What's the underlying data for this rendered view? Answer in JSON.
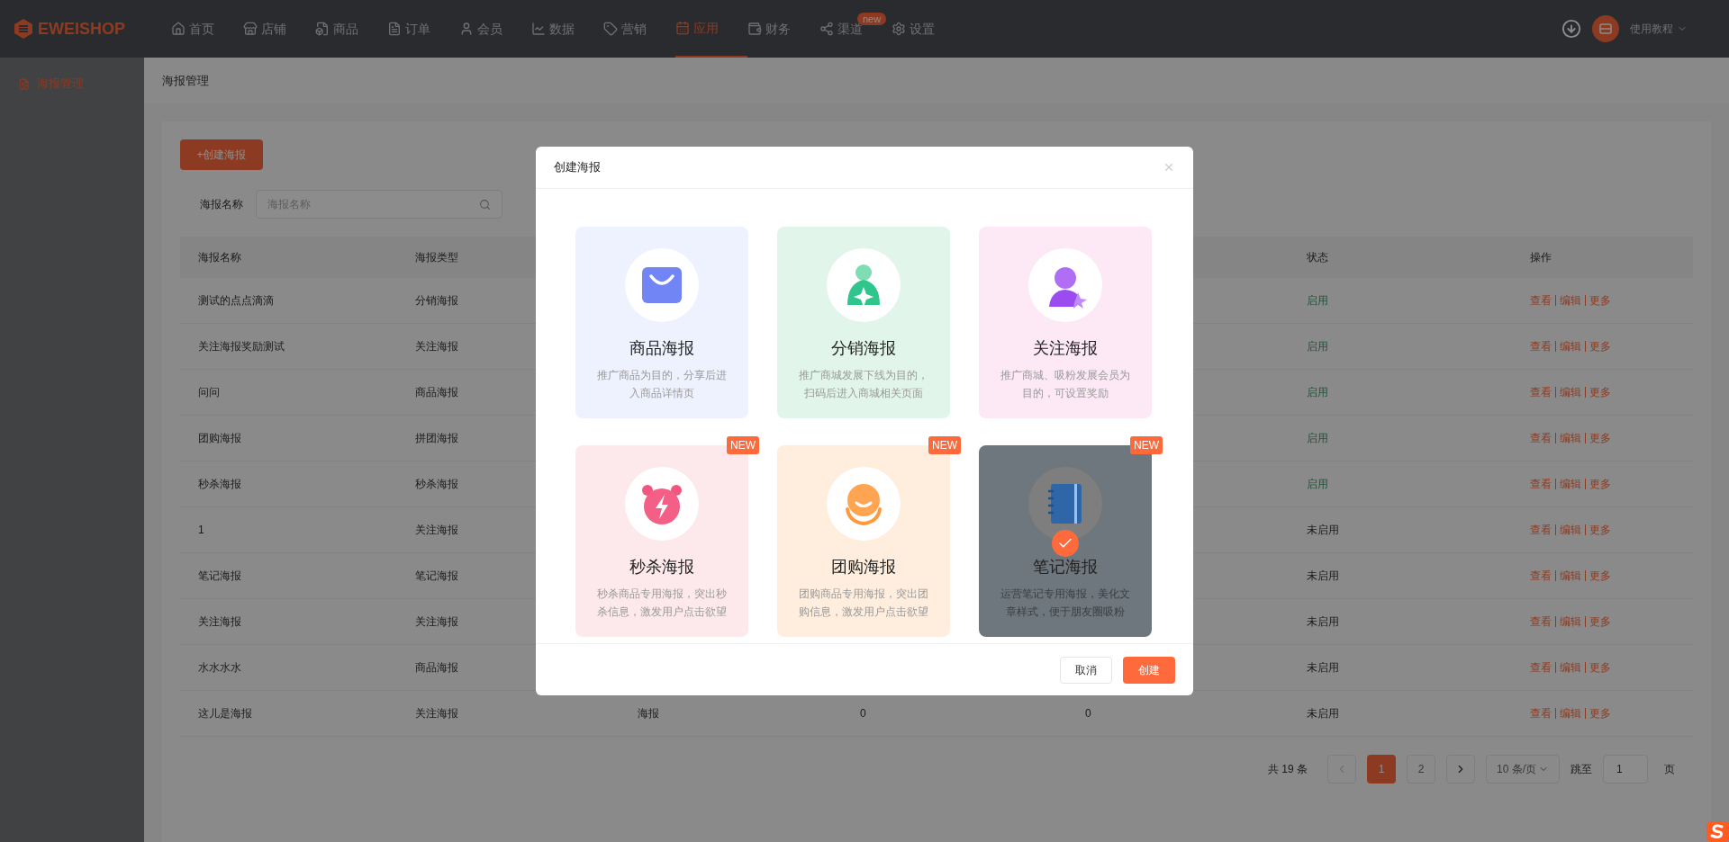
{
  "logo": {
    "text": "EWEISHOP"
  },
  "nav": [
    {
      "label": "首页",
      "selected": false
    },
    {
      "label": "店铺",
      "selected": false
    },
    {
      "label": "商品",
      "selected": false
    },
    {
      "label": "订单",
      "selected": false
    },
    {
      "label": "会员",
      "selected": false
    },
    {
      "label": "数据",
      "selected": false
    },
    {
      "label": "营销",
      "selected": false
    },
    {
      "label": "应用",
      "selected": true
    },
    {
      "label": "财务",
      "selected": false
    },
    {
      "label": "渠道",
      "selected": false,
      "badge": "new"
    },
    {
      "label": "设置",
      "selected": false
    }
  ],
  "user_menu": {
    "label": "使用教程"
  },
  "sidebar": {
    "items": [
      {
        "label": "海报管理",
        "selected": true
      }
    ]
  },
  "page_title": "海报管理",
  "create_button": "+创建海报",
  "search": {
    "label": "海报名称",
    "placeholder": "海报名称"
  },
  "table": {
    "columns": [
      "海报名称",
      "海报类型",
      "状态",
      "操作"
    ],
    "rows": [
      {
        "name": "测试的点点滴滴",
        "type": "分销海报",
        "status": "启用",
        "enabled": true,
        "actions": [
          "查看",
          "编辑",
          "更多"
        ]
      },
      {
        "name": "关注海报奖励测试",
        "type": "关注海报",
        "status": "启用",
        "enabled": true,
        "actions": [
          "查看",
          "编辑",
          "更多"
        ]
      },
      {
        "name": "问问",
        "type": "商品海报",
        "status": "启用",
        "enabled": true,
        "actions": [
          "查看",
          "编辑",
          "更多"
        ]
      },
      {
        "name": "团购海报",
        "type": "拼团海报",
        "status": "启用",
        "enabled": true,
        "actions": [
          "查看",
          "编辑",
          "更多"
        ]
      },
      {
        "name": "秒杀海报",
        "type": "秒杀海报",
        "status": "启用",
        "enabled": true,
        "actions": [
          "查看",
          "编辑",
          "更多"
        ]
      },
      {
        "name": "1",
        "type": "关注海报",
        "status": "未启用",
        "enabled": false,
        "actions": [
          "查看",
          "编辑",
          "更多"
        ]
      },
      {
        "name": "笔记海报",
        "type": "笔记海报",
        "status": "未启用",
        "enabled": false,
        "actions": [
          "查看",
          "编辑",
          "更多"
        ]
      },
      {
        "name": "关注海报",
        "type": "关注海报",
        "status": "未启用",
        "enabled": false,
        "actions": [
          "查看",
          "编辑",
          "更多"
        ]
      },
      {
        "name": "水水水水",
        "type": "商品海报",
        "status": "未启用",
        "enabled": false,
        "actions": [
          "查看",
          "编辑",
          "更多"
        ]
      },
      {
        "name": "这儿是海报",
        "type": "关注海报",
        "column_3": "海报",
        "column_4": "0",
        "column_5": "0",
        "status": "未启用",
        "enabled": false,
        "actions": [
          "查看",
          "编辑",
          "更多"
        ]
      }
    ]
  },
  "pagination": {
    "total": "共 19 条",
    "pages": [
      {
        "label": "1",
        "selected": true
      },
      {
        "label": "2",
        "selected": false
      }
    ],
    "page_size": "10 条/页",
    "jump_label": "跳至",
    "jump_value": "1",
    "page_suffix": "页"
  },
  "dialog": {
    "title": "创建海报",
    "cards": [
      {
        "kind": "product",
        "title": "商品海报",
        "description": "推广商品为目的，分享后进入商品详情页",
        "selected": false
      },
      {
        "kind": "distribution",
        "title": "分销海报",
        "description": "推广商城发展下线为目的，扫码后进入商城相关页面",
        "selected": false
      },
      {
        "kind": "follow",
        "title": "关注海报",
        "description": "推广商城、吸粉发展会员为目的，可设置奖励",
        "selected": false
      },
      {
        "kind": "flash",
        "title": "秒杀海报",
        "description": "秒杀商品专用海报，突出秒杀信息，激发用户点击欲望",
        "badge": "NEW",
        "selected": false
      },
      {
        "kind": "group",
        "title": "团购海报",
        "description": "团购商品专用海报，突出团购信息，激发用户点击欲望",
        "badge": "NEW",
        "selected": false
      },
      {
        "kind": "note",
        "title": "笔记海报",
        "description": "运营笔记专用海报，美化文章样式，便于朋友圈吸粉",
        "badge": "NEW",
        "selected": true
      }
    ],
    "buttons": [
      {
        "label": "取消",
        "kind": "secondary"
      },
      {
        "label": "创建",
        "kind": "primary"
      }
    ]
  }
}
